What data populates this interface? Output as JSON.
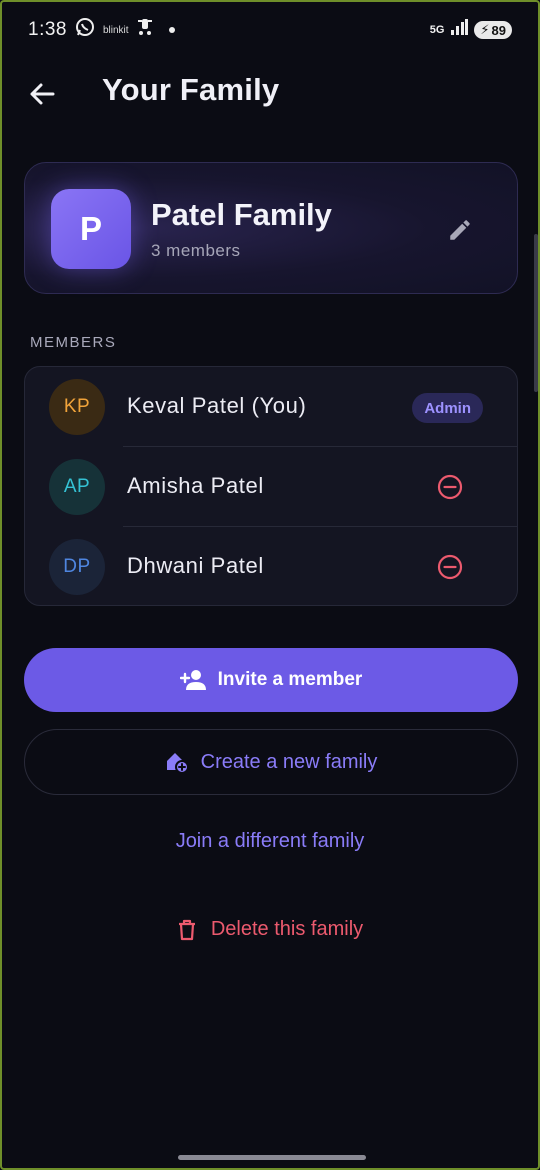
{
  "status_bar": {
    "time": "1:38",
    "app_chip": "blinkit",
    "network": "5G",
    "battery": "89"
  },
  "header": {
    "title": "Your Family"
  },
  "family": {
    "initial": "P",
    "name": "Patel Family",
    "member_count": "3 members"
  },
  "members_section": {
    "label": "MEMBERS",
    "members": [
      {
        "initials": "KP",
        "name": "Keval Patel (You)",
        "badge": "Admin",
        "avatar_bg": "#3a2a14",
        "avatar_fg": "#f0a33a"
      },
      {
        "initials": "AP",
        "name": "Amisha Patel",
        "avatar_bg": "#163238",
        "avatar_fg": "#35c2d4"
      },
      {
        "initials": "DP",
        "name": "Dhwani Patel",
        "avatar_bg": "#1b2438",
        "avatar_fg": "#4f86e0"
      }
    ]
  },
  "actions": {
    "invite_label": "Invite a member",
    "create_label": "Create a new family",
    "join_label": "Join a different family",
    "delete_label": "Delete this family"
  },
  "colors": {
    "accent": "#6c5ae6",
    "accent_text": "#8a7cf8",
    "danger": "#ec5a6e",
    "background": "#0b0c14"
  },
  "icons": {
    "back": "arrow-left-icon",
    "edit": "pencil-icon",
    "remove": "minus-circle-icon",
    "invite": "person-add-icon",
    "create": "home-add-icon",
    "delete": "trash-icon"
  }
}
